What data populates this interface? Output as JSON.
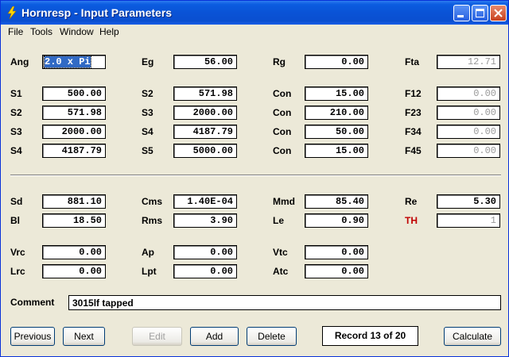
{
  "window": {
    "title": "Hornresp - Input Parameters"
  },
  "menu": [
    "File",
    "Tools",
    "Window",
    "Help"
  ],
  "rows": [
    [
      {
        "label": "Ang",
        "value": "2.0 x Pi",
        "selected": true
      },
      {
        "label": "Eg",
        "value": "56.00"
      },
      {
        "label": "Rg",
        "value": "0.00"
      },
      {
        "label": "Fta",
        "value": "12.71",
        "disabled": true
      }
    ],
    [
      {
        "label": "S1",
        "value": "500.00"
      },
      {
        "label": "S2",
        "value": "571.98"
      },
      {
        "label": "Con",
        "value": "15.00"
      },
      {
        "label": "F12",
        "value": "0.00",
        "disabled": true
      }
    ],
    [
      {
        "label": "S2",
        "value": "571.98"
      },
      {
        "label": "S3",
        "value": "2000.00"
      },
      {
        "label": "Con",
        "value": "210.00"
      },
      {
        "label": "F23",
        "value": "0.00",
        "disabled": true
      }
    ],
    [
      {
        "label": "S3",
        "value": "2000.00"
      },
      {
        "label": "S4",
        "value": "4187.79"
      },
      {
        "label": "Con",
        "value": "50.00"
      },
      {
        "label": "F34",
        "value": "0.00",
        "disabled": true
      }
    ],
    [
      {
        "label": "S4",
        "value": "4187.79"
      },
      {
        "label": "S5",
        "value": "5000.00"
      },
      {
        "label": "Con",
        "value": "15.00"
      },
      {
        "label": "F45",
        "value": "0.00",
        "disabled": true
      }
    ],
    [
      {
        "label": "Sd",
        "value": "881.10"
      },
      {
        "label": "Cms",
        "value": "1.40E-04"
      },
      {
        "label": "Mmd",
        "value": "85.40"
      },
      {
        "label": "Re",
        "value": "5.30"
      }
    ],
    [
      {
        "label": "Bl",
        "value": "18.50"
      },
      {
        "label": "Rms",
        "value": "3.90"
      },
      {
        "label": "Le",
        "value": "0.90"
      },
      {
        "label": "TH",
        "value": "1",
        "disabled": true,
        "red_label": true
      }
    ],
    [
      {
        "label": "Vrc",
        "value": "0.00"
      },
      {
        "label": "Ap",
        "value": "0.00"
      },
      {
        "label": "Vtc",
        "value": "0.00"
      }
    ],
    [
      {
        "label": "Lrc",
        "value": "0.00"
      },
      {
        "label": "Lpt",
        "value": "0.00"
      },
      {
        "label": "Atc",
        "value": "0.00"
      }
    ]
  ],
  "comment": {
    "label": "Comment",
    "value": "3015lf tapped"
  },
  "buttons": {
    "previous": "Previous",
    "next": "Next",
    "edit": "Edit",
    "add": "Add",
    "delete": "Delete",
    "calculate": "Calculate"
  },
  "record": "Record 13 of 20",
  "colors": {
    "title_bar": "#0a53d6",
    "face": "#ece9d8",
    "selection": "#316ac5",
    "th_label": "#c00000"
  }
}
